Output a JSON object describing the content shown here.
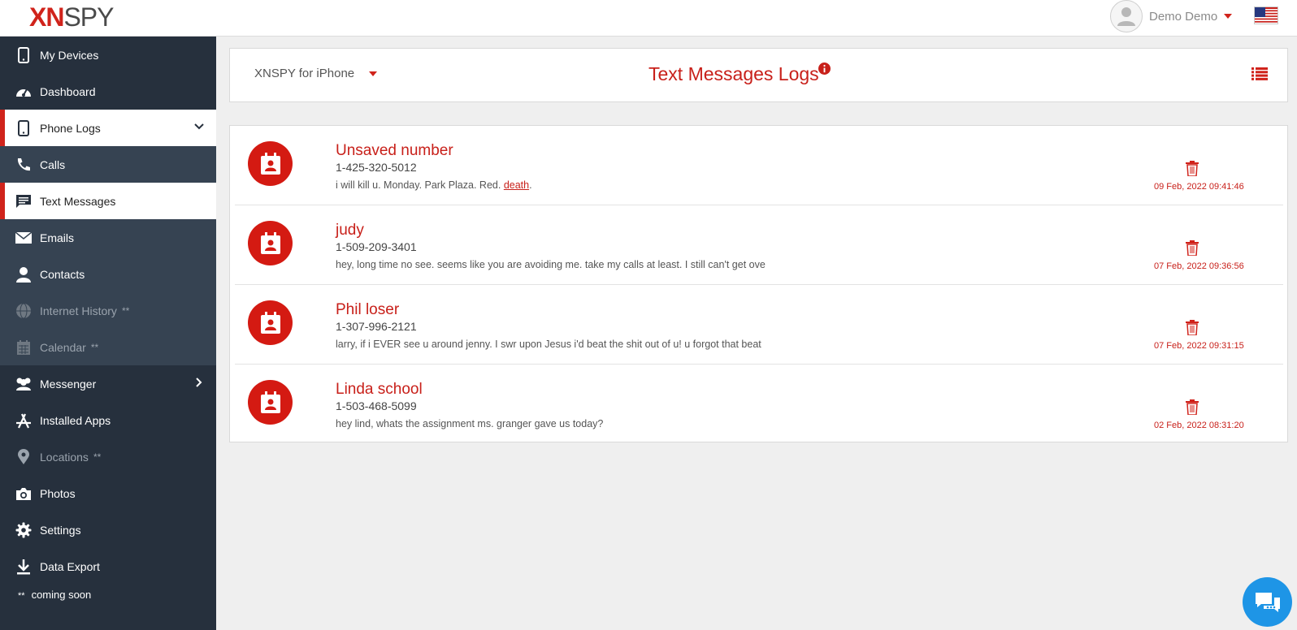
{
  "app": {
    "logo_main": "XN",
    "logo_sub": "SPY",
    "user_name": "Demo Demo"
  },
  "colors": {
    "accent": "#d0231b",
    "sidebar_bg": "#26303d",
    "sidebar_sub_bg": "#364352",
    "chat_blue": "#1e95e6"
  },
  "sidebar": {
    "items": [
      {
        "label": "My Devices",
        "icon": "phone-icon"
      },
      {
        "label": "Dashboard",
        "icon": "speedometer-icon"
      },
      {
        "label": "Phone Logs",
        "icon": "phone-icon",
        "expanded": true
      },
      {
        "label": "Calls",
        "icon": "handset-icon"
      },
      {
        "label": "Text Messages",
        "icon": "message-icon",
        "active": true
      },
      {
        "label": "Emails",
        "icon": "envelope-icon"
      },
      {
        "label": "Contacts",
        "icon": "person-icon"
      },
      {
        "label": "Internet History",
        "icon": "globe-icon",
        "disabled": true
      },
      {
        "label": "Calendar",
        "icon": "calendar-icon",
        "disabled": true
      },
      {
        "label": "Messenger",
        "icon": "users-icon"
      },
      {
        "label": "Installed Apps",
        "icon": "app-store-icon"
      },
      {
        "label": "Locations",
        "icon": "map-pin-icon",
        "disabled": true
      },
      {
        "label": "Photos",
        "icon": "camera-icon"
      },
      {
        "label": "Settings",
        "icon": "gear-icon"
      },
      {
        "label": "Data Export",
        "icon": "download-icon"
      }
    ],
    "coming_soon_marker": "**",
    "coming_soon_label": "coming soon"
  },
  "header": {
    "device_label": "XNSPY for iPhone",
    "title": "Text Messages Logs"
  },
  "messages": [
    {
      "name": "Unsaved number",
      "number": "1-425-320-5012",
      "text": "i will kill u. Monday. Park Plaza. Red.",
      "highlight": "death",
      "after": ".",
      "date": "09 Feb, 2022 09:41:46"
    },
    {
      "name": "judy",
      "number": "1-509-209-3401",
      "text": "hey, long time no see. seems like you are avoiding me. take my calls at least. I still can't get ove",
      "highlight": "",
      "after": "",
      "date": "07 Feb, 2022 09:36:56"
    },
    {
      "name": "Phil loser",
      "number": "1-307-996-2121",
      "text": "larry, if i EVER see u around jenny. I swr upon Jesus i'd beat the shit out of u! u forgot that beat",
      "highlight": "",
      "after": "",
      "date": "07 Feb, 2022 09:31:15"
    },
    {
      "name": "Linda school",
      "number": "1-503-468-5099",
      "text": "hey lind, whats the assignment ms. granger gave us today?",
      "highlight": "",
      "after": "",
      "date": "02 Feb, 2022 08:31:20"
    }
  ]
}
